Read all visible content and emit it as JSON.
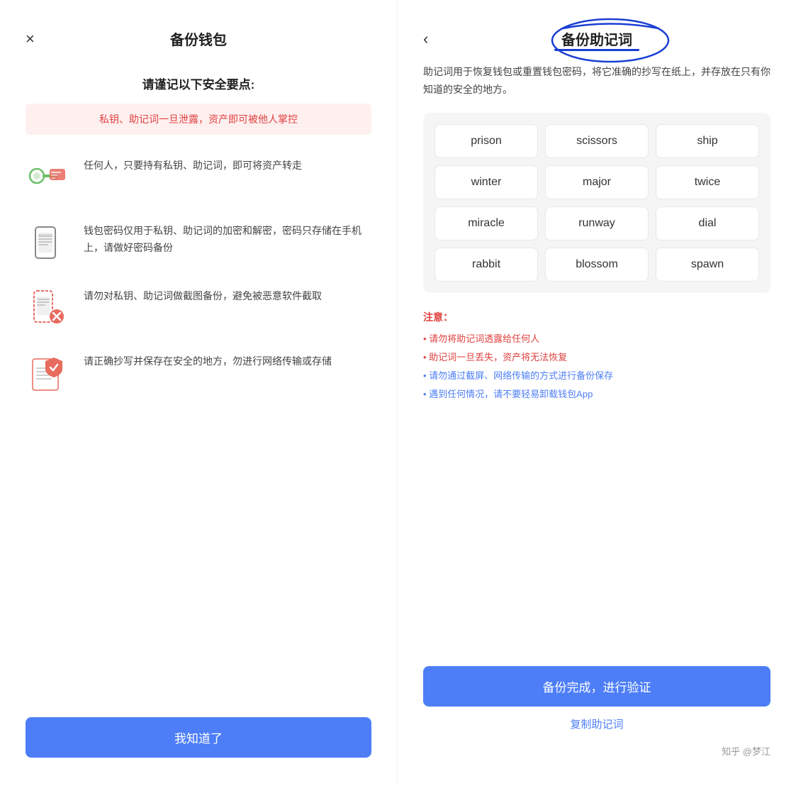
{
  "left": {
    "close_label": "×",
    "title": "备份钱包",
    "safety_heading": "请谨记以下安全要点:",
    "warning_text": "私钥、助记词一旦泄露，资产即可被他人掌控",
    "features": [
      {
        "icon": "key-wallet",
        "text": "任何人，只要持有私钥、助记词，即可将资产转走"
      },
      {
        "icon": "phone-lock",
        "text": "钱包密码仅用于私钥、助记词的加密和解密，密码只存储在手机上，请做好密码备份"
      },
      {
        "icon": "phone-screenshot",
        "text": "请勿对私钥、助记词做截图备份，避免被恶意软件截取"
      },
      {
        "icon": "document-safe",
        "text": "请正确抄写并保存在安全的地方，勿进行网络传输或存储"
      }
    ],
    "confirm_btn": "我知道了"
  },
  "right": {
    "back_label": "‹",
    "title": "备份助记词",
    "desc": "助记词用于恢复钱包或重置钱包密码，将它准确的抄写在纸上，并存放在只有你知道的安全的地方。",
    "mnemonic_words": [
      "prison",
      "scissors",
      "ship",
      "winter",
      "major",
      "twice",
      "miracle",
      "runway",
      "dial",
      "rabbit",
      "blossom",
      "spawn"
    ],
    "notice_title": "注意：",
    "notices": [
      {
        "text": "• 请勿将助记词透露给任何人",
        "color": "red"
      },
      {
        "text": "• 助记词一旦丢失，资产将无法恢复",
        "color": "red"
      },
      {
        "text": "• 请勿通过截屏、网络传输的方式进行备份保存",
        "color": "blue"
      },
      {
        "text": "• 遇到任何情况，请不要轻易卸载钱包App",
        "color": "blue"
      }
    ],
    "verify_btn": "备份完成，进行验证",
    "copy_link": "复制助记词",
    "watermark": "知乎 @梦江"
  }
}
